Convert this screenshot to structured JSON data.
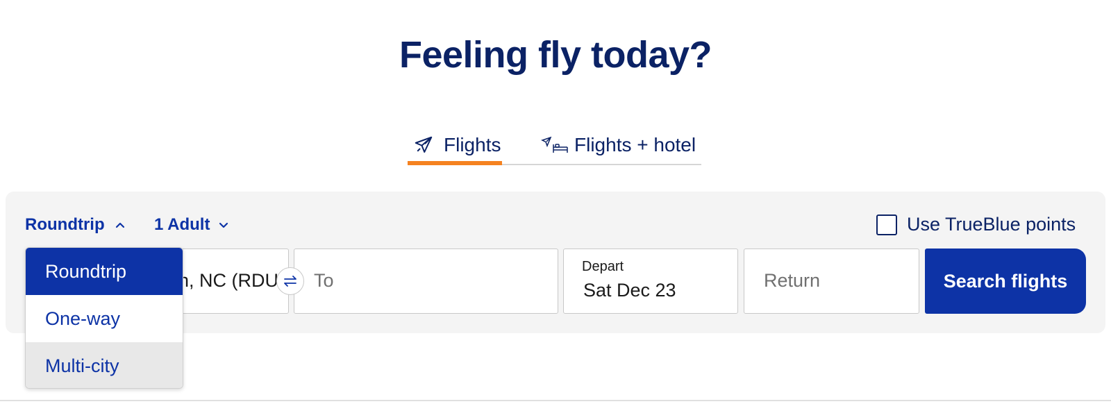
{
  "headline": "Feeling fly today?",
  "tabs": [
    {
      "label": "Flights",
      "icon": "airplane-icon",
      "active": true
    },
    {
      "label": "Flights + hotel",
      "icon": "plane-bed-icon",
      "active": false
    }
  ],
  "trip_type": {
    "selected": "Roundtrip",
    "options": [
      "Roundtrip",
      "One-way",
      "Multi-city"
    ]
  },
  "passengers": {
    "label": "1 Adult"
  },
  "trueblue": {
    "label": "Use TrueBlue points",
    "checked": false
  },
  "fields": {
    "from_value": "n, NC (RDU",
    "to_placeholder": "To",
    "depart_label": "Depart",
    "depart_value": "Sat Dec 23",
    "return_placeholder": "Return"
  },
  "search_button": "Search flights",
  "colors": {
    "brand_navy": "#0b2265",
    "brand_blue": "#0d33a6",
    "accent_orange": "#f58220",
    "panel_bg": "#f4f4f4"
  }
}
